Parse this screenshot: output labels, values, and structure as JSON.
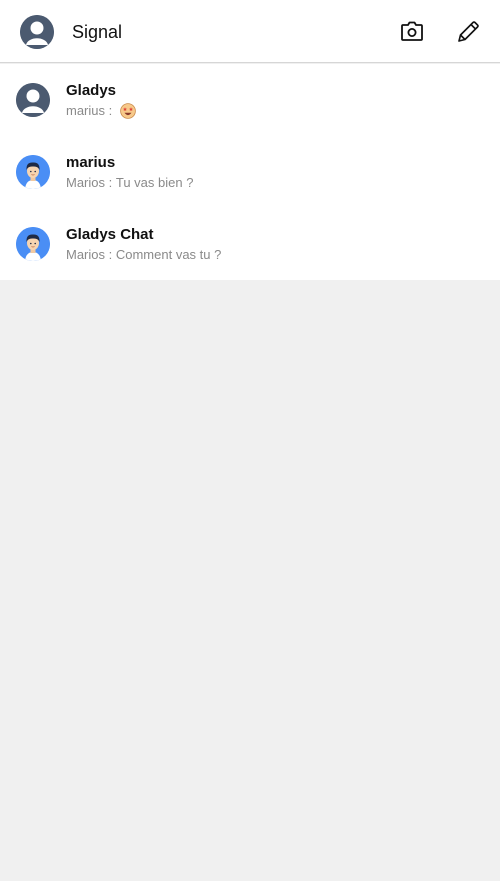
{
  "header": {
    "title": "Signal",
    "profile_icon": "user-avatar-icon",
    "camera_icon": "camera-icon",
    "compose_icon": "pencil-icon"
  },
  "chats": [
    {
      "name": "Gladys",
      "sender": "marius",
      "separator": " : ",
      "message": "",
      "emoji": "star-struck-emoji",
      "avatar": "default-avatar-icon"
    },
    {
      "name": "marius",
      "sender": "Marios",
      "separator": " : ",
      "message": "Tu vas bien ?",
      "avatar": "person-avatar-icon"
    },
    {
      "name": "Gladys Chat",
      "sender": "Marios",
      "separator": " : ",
      "message": "Comment vas tu ?",
      "avatar": "person-avatar-icon"
    }
  ],
  "colors": {
    "header_bg": "#ffffff",
    "page_bg": "#f0f0f0",
    "default_avatar": "#4b5a70",
    "person_avatar": "#4a8ef5",
    "preview_text": "#8a8a8a"
  }
}
